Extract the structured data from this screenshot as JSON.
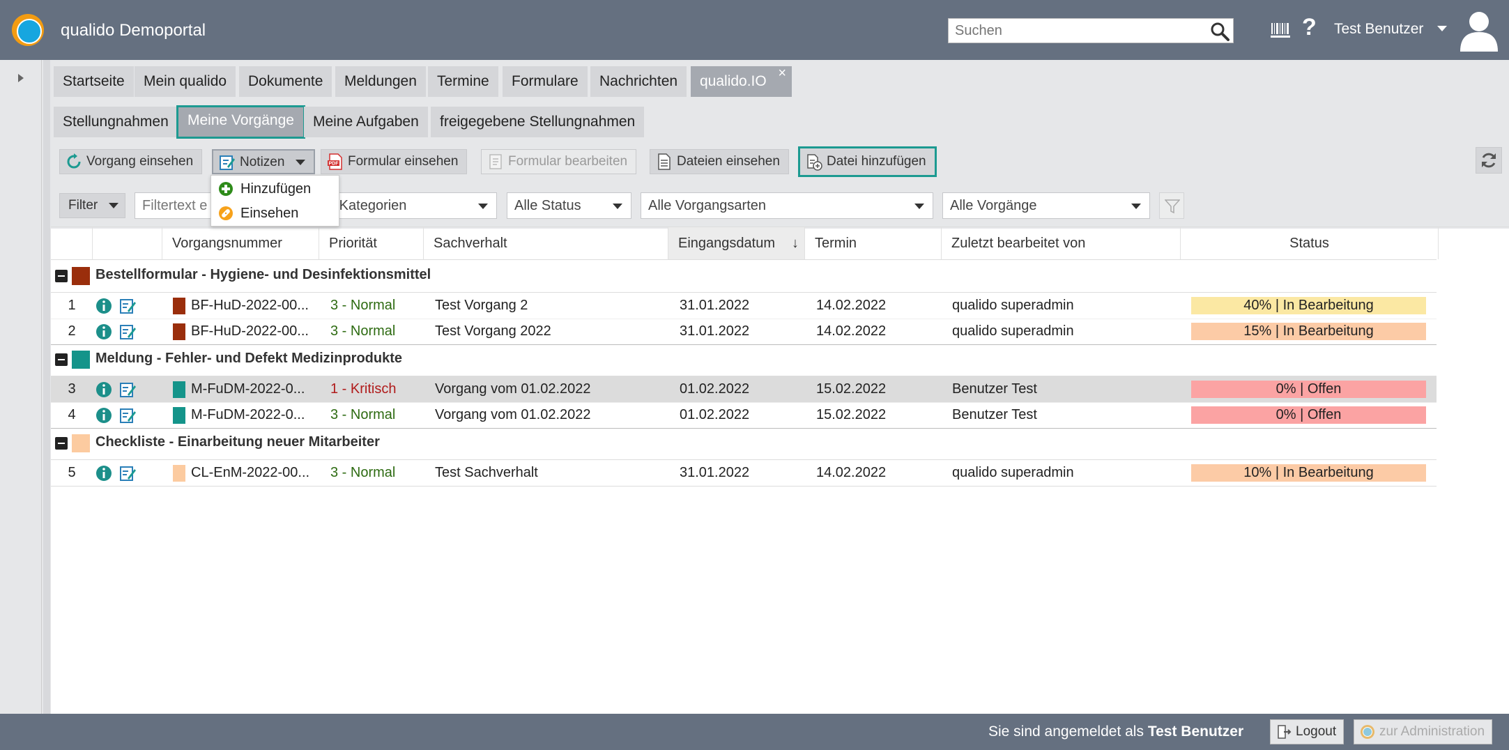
{
  "app": {
    "title": "qualido Demoportal",
    "search_placeholder": "Suchen",
    "user_name": "Test Benutzer"
  },
  "main_tabs": [
    {
      "label": "Startseite"
    },
    {
      "label": "Mein qualido"
    },
    {
      "label": "Dokumente"
    },
    {
      "label": "Meldungen"
    },
    {
      "label": "Termine"
    },
    {
      "label": "Formulare"
    },
    {
      "label": "Nachrichten"
    },
    {
      "label": "qualido.IO",
      "close": "×"
    }
  ],
  "sub_tabs": [
    {
      "label": "Stellungnahmen"
    },
    {
      "label": "Meine Vorgänge"
    },
    {
      "label": "Meine Aufgaben"
    },
    {
      "label": "freigegebene Stellungnahmen"
    }
  ],
  "toolbar": {
    "view_case": "Vorgang einsehen",
    "notes": "Notizen",
    "view_form": "Formular einsehen",
    "edit_form": "Formular bearbeiten",
    "view_files": "Dateien einsehen",
    "add_file": "Datei hinzufügen"
  },
  "notes_menu": {
    "add": "Hinzufügen",
    "view": "Einsehen"
  },
  "filters": {
    "filter_label": "Filter",
    "text_placeholder": "Filtertext e",
    "category": "e Kategorien",
    "status": "Alle Status",
    "case_types": "Alle Vorgangsarten",
    "cases": "Alle Vorgänge"
  },
  "columns": {
    "number": "Vorgangsnummer",
    "priority": "Priorität",
    "subject": "Sachverhalt",
    "received": "Eingangsdatum",
    "sort_indicator": "↓",
    "due": "Termin",
    "last_edited": "Zuletzt bearbeitet von",
    "status": "Status"
  },
  "groups": [
    {
      "label": "Bestellformular - Hygiene- und Desinfektionsmittel",
      "color": "#9a2e0c",
      "rows": [
        {
          "idx": "1",
          "number": "BF-HuD-2022-00...",
          "priority": "3 - Normal",
          "priority_color": "#2e6b12",
          "subject": "Test Vorgang 2",
          "received": "31.01.2022",
          "due": "14.02.2022",
          "editor": "qualido superadmin",
          "status": "40% | In Bearbeitung",
          "status_color": "#fbe8a3",
          "selected": false
        },
        {
          "idx": "2",
          "number": "BF-HuD-2022-00...",
          "priority": "3 - Normal",
          "priority_color": "#2e6b12",
          "subject": "Test Vorgang 2022",
          "received": "31.01.2022",
          "due": "14.02.2022",
          "editor": "qualido superadmin",
          "status": "15% | In Bearbeitung",
          "status_color": "#fccba6",
          "selected": false
        }
      ]
    },
    {
      "label": "Meldung - Fehler- und Defekt Medizinprodukte",
      "color": "#14948a",
      "rows": [
        {
          "idx": "3",
          "number": "M-FuDM-2022-0...",
          "priority": "1 - Kritisch",
          "priority_color": "#b01b1b",
          "subject": "Vorgang vom 01.02.2022",
          "received": "01.02.2022",
          "due": "15.02.2022",
          "editor": "Benutzer Test",
          "status": "0% | Offen",
          "status_color": "#fba3a3",
          "selected": true
        },
        {
          "idx": "4",
          "number": "M-FuDM-2022-0...",
          "priority": "3 - Normal",
          "priority_color": "#2e6b12",
          "subject": "Vorgang vom 01.02.2022",
          "received": "01.02.2022",
          "due": "15.02.2022",
          "editor": "Benutzer Test",
          "status": "0% | Offen",
          "status_color": "#fba3a3",
          "selected": false
        }
      ]
    },
    {
      "label": "Checkliste - Einarbeitung neuer Mitarbeiter",
      "color": "#fccba0",
      "rows": [
        {
          "idx": "5",
          "number": "CL-EnM-2022-00...",
          "priority": "3 - Normal",
          "priority_color": "#2e6b12",
          "subject": "Test Sachverhalt",
          "received": "31.01.2022",
          "due": "14.02.2022",
          "editor": "qualido superadmin",
          "status": "10% | In Bearbeitung",
          "status_color": "#fccba6",
          "selected": false
        }
      ]
    }
  ],
  "footer": {
    "logged_in_prefix": "Sie sind angemeldet als",
    "logged_in_user": "Test Benutzer",
    "logout": "Logout",
    "admin": "zur Administration"
  }
}
